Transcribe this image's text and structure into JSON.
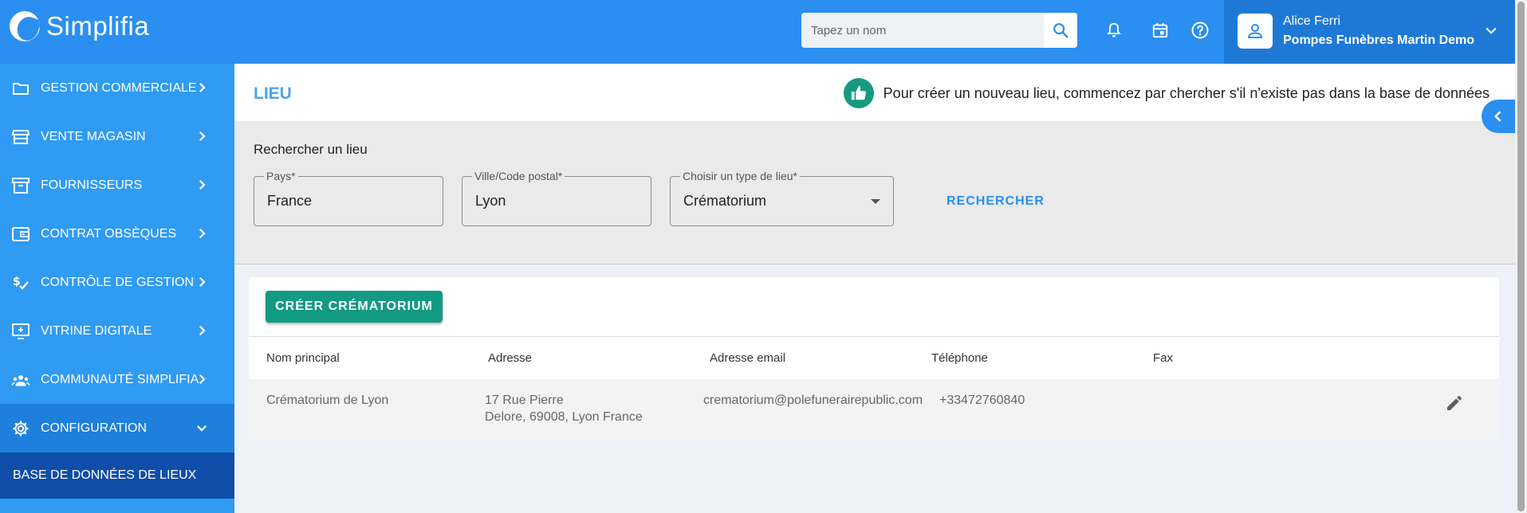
{
  "app": {
    "brand": "Simplifia",
    "search_placeholder": "Tapez un nom",
    "icons": {
      "search": "search-icon",
      "notifications": "bell-icon",
      "calendar": "calendar-icon",
      "help": "help-icon"
    },
    "user": {
      "name": "Alice Ferri",
      "company": "Pompes Funèbres Martin Demo"
    }
  },
  "sidebar": {
    "items": [
      {
        "label": "GESTION COMMERCIALE",
        "icon": "folder-icon"
      },
      {
        "label": "VENTE MAGASIN",
        "icon": "store-icon"
      },
      {
        "label": "FOURNISSEURS",
        "icon": "archive-icon"
      },
      {
        "label": "CONTRAT OBSÈQUES",
        "icon": "wallet-icon"
      },
      {
        "label": "CONTRÔLE DE GESTION",
        "icon": "money-check-icon"
      },
      {
        "label": "VITRINE DIGITALE",
        "icon": "monitor-icon"
      },
      {
        "label": "COMMUNAUTÉ SIMPLIFIA",
        "icon": "people-icon"
      },
      {
        "label": "CONFIGURATION",
        "icon": "gear-icon",
        "expanded": true
      }
    ],
    "subitem": "BASE DE DONNÉES DE LIEUX"
  },
  "page": {
    "title": "LIEU",
    "hint": "Pour créer un nouveau lieu, commencez par chercher s'il n'existe pas dans la base de données"
  },
  "search_form": {
    "title": "Rechercher un lieu",
    "country": {
      "label": "Pays*",
      "value": "France"
    },
    "city": {
      "label": "Ville/Code postal*",
      "value": "Lyon"
    },
    "type": {
      "label": "Choisir un type de lieu*",
      "value": "Crématorium"
    },
    "submit_label": "RECHERCHER"
  },
  "results": {
    "create_label": "CRÉER CRÉMATORIUM",
    "columns": [
      "Nom principal",
      "Adresse",
      "Adresse email",
      "Téléphone",
      "Fax"
    ],
    "rows": [
      {
        "name": "Crématorium de Lyon",
        "address_line1": "17 Rue Pierre",
        "address_line2": "Delore, 69008, Lyon France",
        "email": "crematorium@polefunerairepublic.com",
        "phone": "+33472760840",
        "fax": ""
      }
    ]
  },
  "colors": {
    "topbar": "#2a8ff0",
    "sidebar": "#2f9bf2",
    "accent_green": "#139a82",
    "title_blue": "#4aa5ec"
  }
}
